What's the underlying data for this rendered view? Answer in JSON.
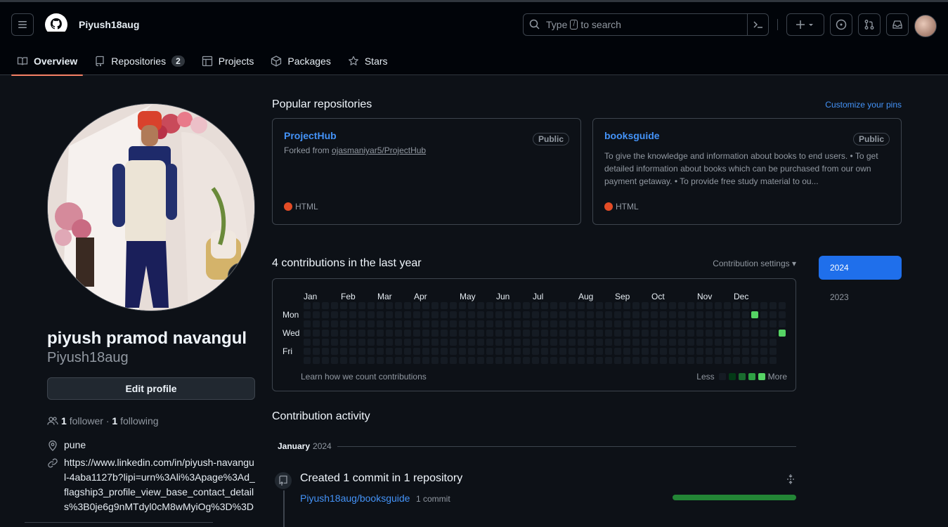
{
  "header": {
    "username": "Piyush18aug",
    "search_placeholder_before": "Type",
    "search_key": "/",
    "search_placeholder_after": "to search"
  },
  "tabs": [
    {
      "label": "Overview",
      "active": true
    },
    {
      "label": "Repositories",
      "count": "2"
    },
    {
      "label": "Projects"
    },
    {
      "label": "Packages"
    },
    {
      "label": "Stars"
    }
  ],
  "profile": {
    "full_name": "piyush pramod navangul",
    "login": "Piyush18aug",
    "edit_label": "Edit profile",
    "followers_count": "1",
    "followers_label": "follower",
    "separator": "·",
    "following_count": "1",
    "following_label": "following",
    "location": "pune",
    "website": "https://www.linkedin.com/in/piyush-navangul-4aba1127b?lipi=urn%3Ali%3Apage%3Ad_flagship3_profile_view_base_contact_details%3B0je6g9nMTdyl0cM8wMyiOg%3D%3D"
  },
  "popular": {
    "title": "Popular repositories",
    "customize": "Customize your pins",
    "repos": [
      {
        "name": "ProjectHub",
        "badge": "Public",
        "forked_prefix": "Forked from",
        "forked_from": "ojasmaniyar5/ProjectHub",
        "language": "HTML",
        "language_color": "#e34c26"
      },
      {
        "name": "booksguide",
        "badge": "Public",
        "description": "To give the knowledge and information about books to end users. • To get detailed information about books which can be purchased from our own payment getaway. • To provide free study material to ou...",
        "language": "HTML",
        "language_color": "#e34c26"
      }
    ]
  },
  "contributions": {
    "title": "4 contributions in the last year",
    "settings": "Contribution settings",
    "months": [
      "Jan",
      "Feb",
      "Mar",
      "Apr",
      "May",
      "Jun",
      "Jul",
      "Aug",
      "Sep",
      "Oct",
      "Nov",
      "Dec"
    ],
    "days": [
      "Mon",
      "Wed",
      "Fri"
    ],
    "learn": "Learn how we count contributions",
    "less": "Less",
    "more": "More",
    "active_cells": [
      {
        "week": 49,
        "day": 1,
        "level": 4
      },
      {
        "week": 52,
        "day": 3,
        "level": 4
      }
    ],
    "level_colors": [
      "#151b23",
      "#033a16",
      "#196c2e",
      "#2ea043",
      "#56d364"
    ]
  },
  "years": [
    {
      "label": "2024",
      "active": true
    },
    {
      "label": "2023"
    }
  ],
  "activity": {
    "title": "Contribution activity",
    "month": "January",
    "year": "2024",
    "item_title": "Created 1 commit in 1 repository",
    "repo": "Piyush18aug/booksguide",
    "commits": "1 commit"
  }
}
